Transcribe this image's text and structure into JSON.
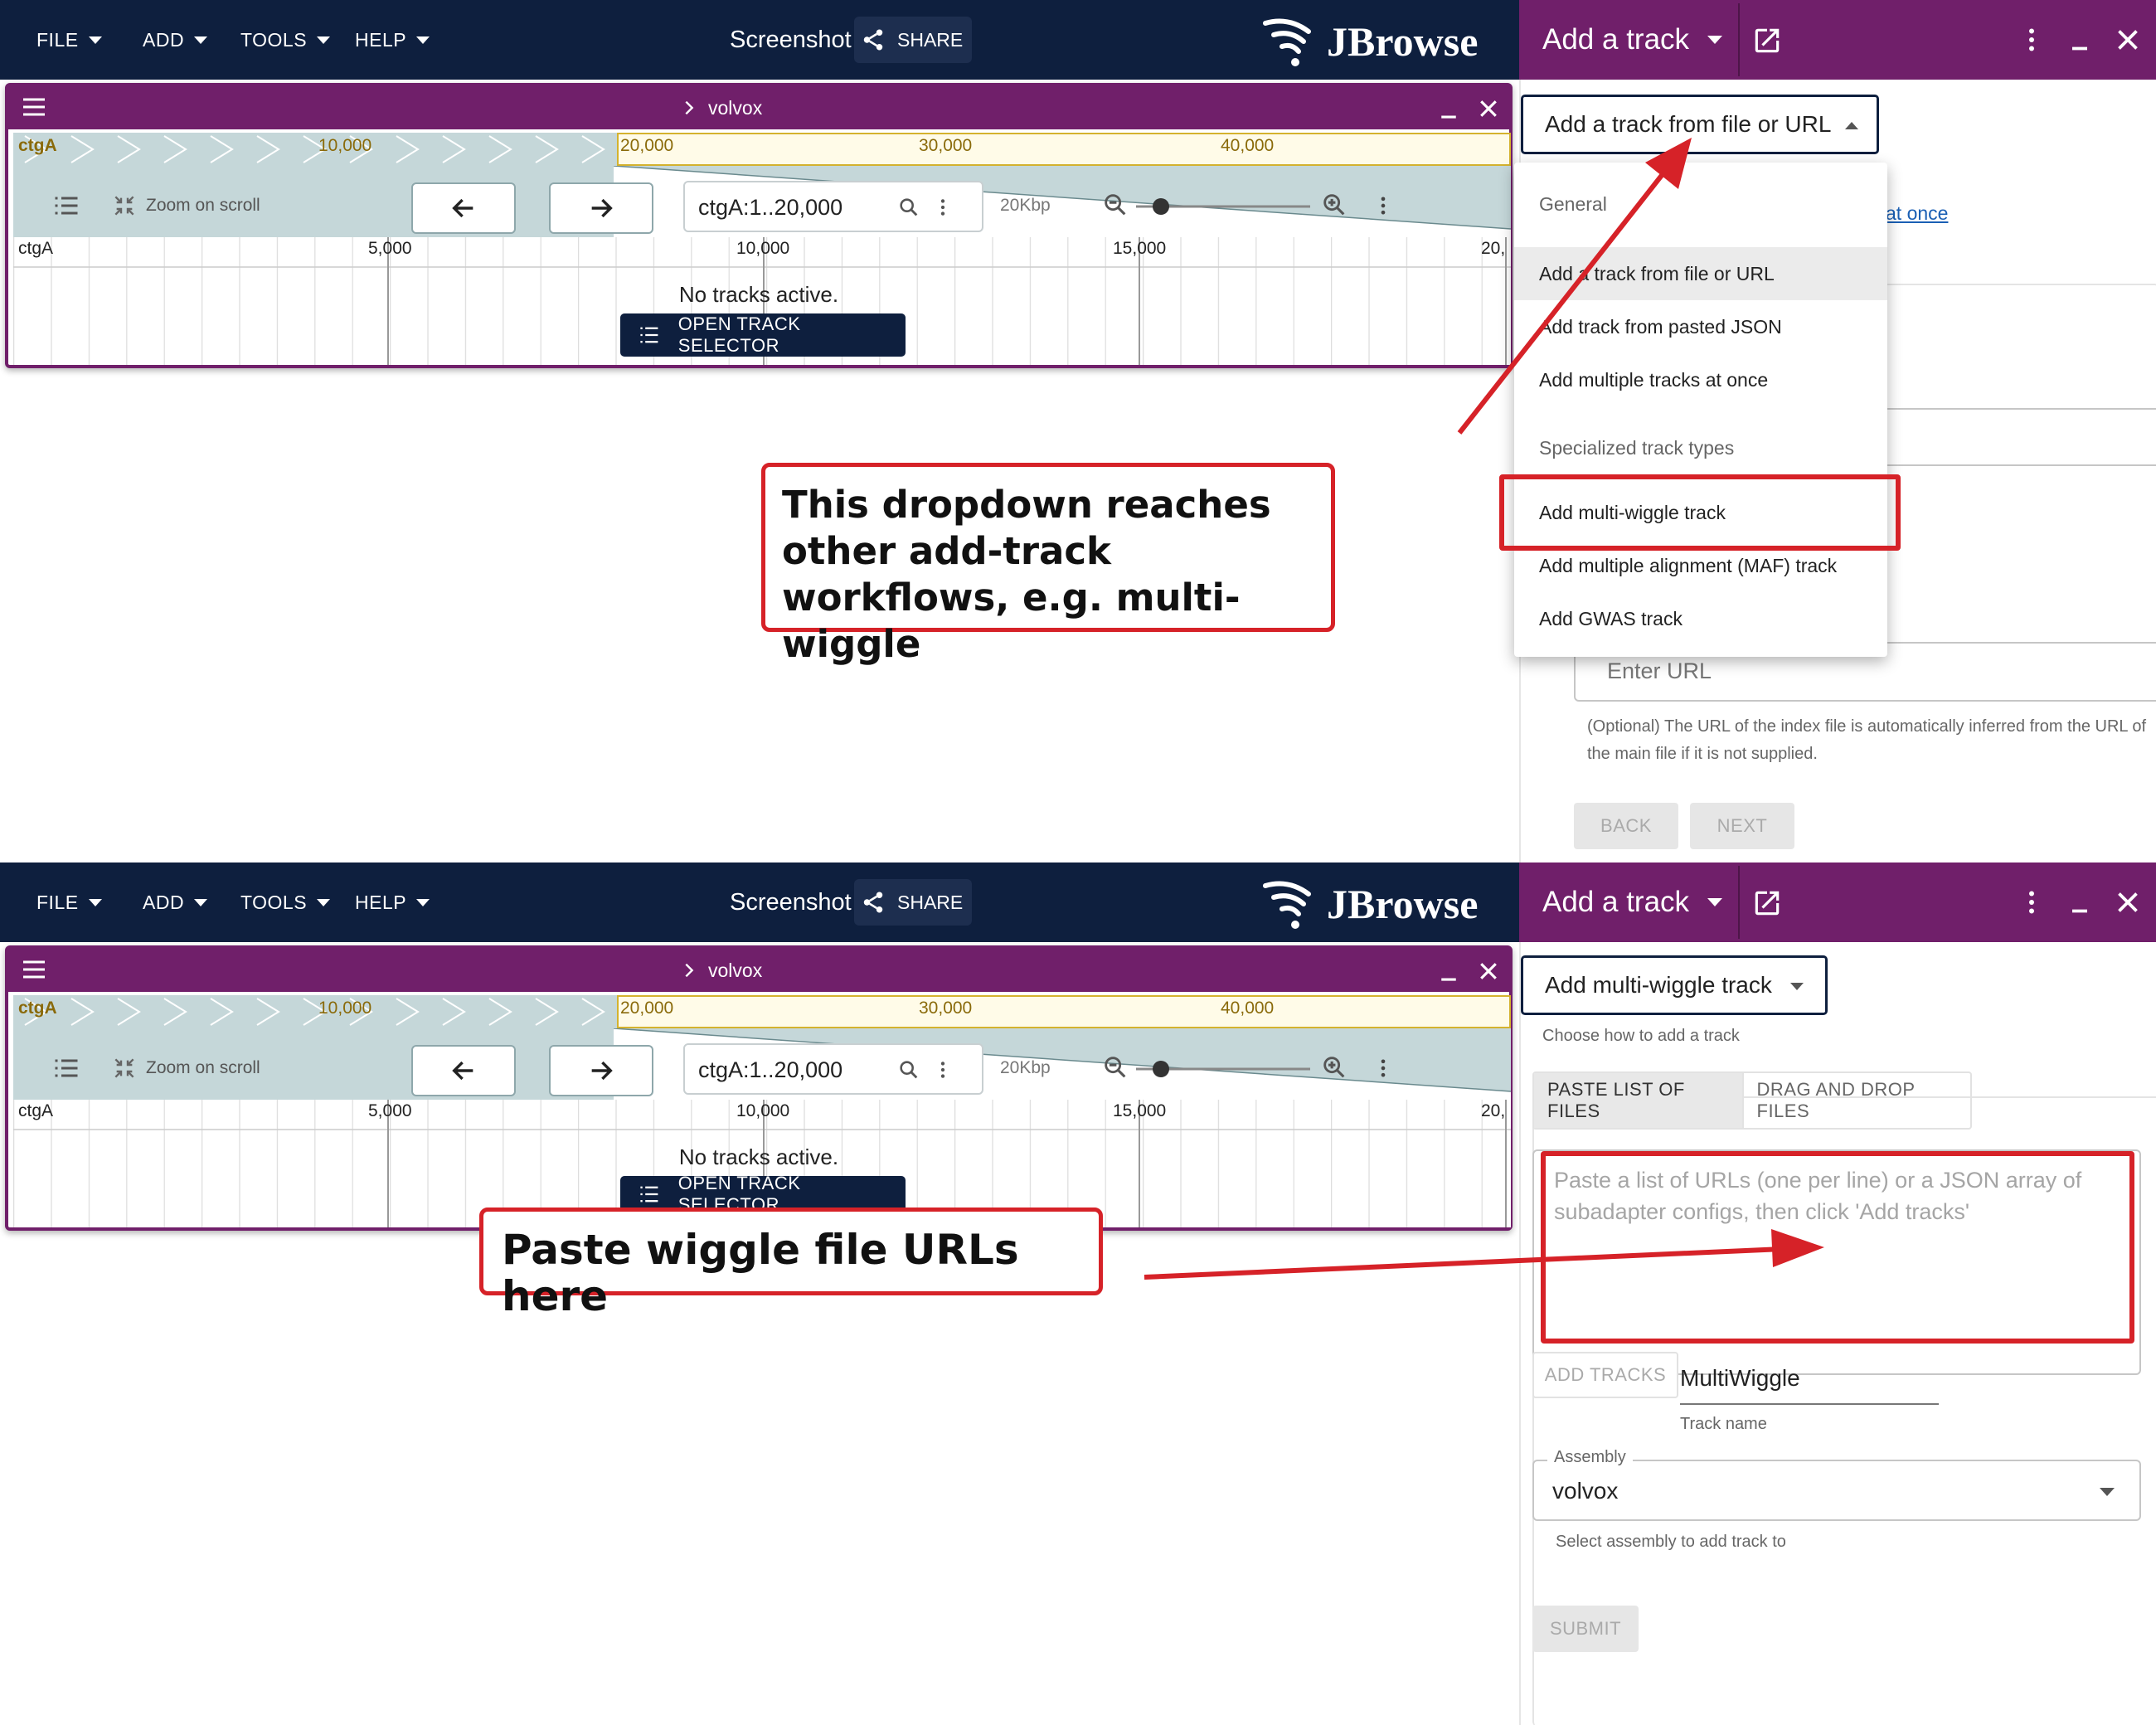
{
  "menu": [
    "FILE",
    "ADD",
    "TOOLS",
    "HELP"
  ],
  "screenshot_label": "Screenshot",
  "share_label": "SHARE",
  "logo_text": "JBrowse",
  "panel_title": "Add a track",
  "view": {
    "assembly": "volvox",
    "overview_labels": [
      "ctgA",
      "10,000",
      "20,000",
      "30,000",
      "40,000"
    ],
    "zoom_label": "Zoom on scroll",
    "location": "ctgA:1..20,000",
    "scale_label": "20Kbp",
    "ruler_labels": [
      "ctgA",
      "5,000",
      "10,000",
      "15,000",
      "20,"
    ],
    "no_tracks": "No tracks active.",
    "open_selector": "OPEN TRACK SELECTOR"
  },
  "top": {
    "select_value": "Add a track from file or URL",
    "dropdown": {
      "header_general": "General",
      "items_general": [
        "Add a track from file or URL",
        "Add track from pasted JSON",
        "Add multiple tracks at once"
      ],
      "header_special": "Specialized track types",
      "items_special": [
        "Add multi-wiggle track",
        "Add multiple alignment (MAF) track",
        "Add GWAS track"
      ]
    },
    "link_fragment": "at once",
    "url_placeholder": "Enter URL",
    "index_help": "(Optional) The URL of the index file is automatically inferred from the URL of the main file if it is not supplied.",
    "back": "BACK",
    "next": "NEXT",
    "annotation": "This dropdown reaches other add-track workflows, e.g. multi-wiggle"
  },
  "bottom": {
    "select_value": "Add multi-wiggle track",
    "select_helper": "Choose how to add a track",
    "tabs": [
      "PASTE LIST OF FILES",
      "DRAG AND DROP FILES"
    ],
    "textarea_placeholder": "Paste a list of URLs (one per line) or a JSON array of subadapter configs, then click 'Add tracks'",
    "add_tracks": "ADD TRACKS",
    "track_name_value": "MultiWiggle",
    "track_name_helper": "Track name",
    "assembly_label": "Assembly",
    "assembly_value": "volvox",
    "assembly_helper": "Select assembly to add track to",
    "submit": "SUBMIT",
    "annotation": "Paste wiggle file URLs here"
  },
  "colors": {
    "navy": "#0e1f3e",
    "purple": "#701f6a",
    "annotation_red": "#d62228",
    "overview": "#c5d7d9"
  }
}
